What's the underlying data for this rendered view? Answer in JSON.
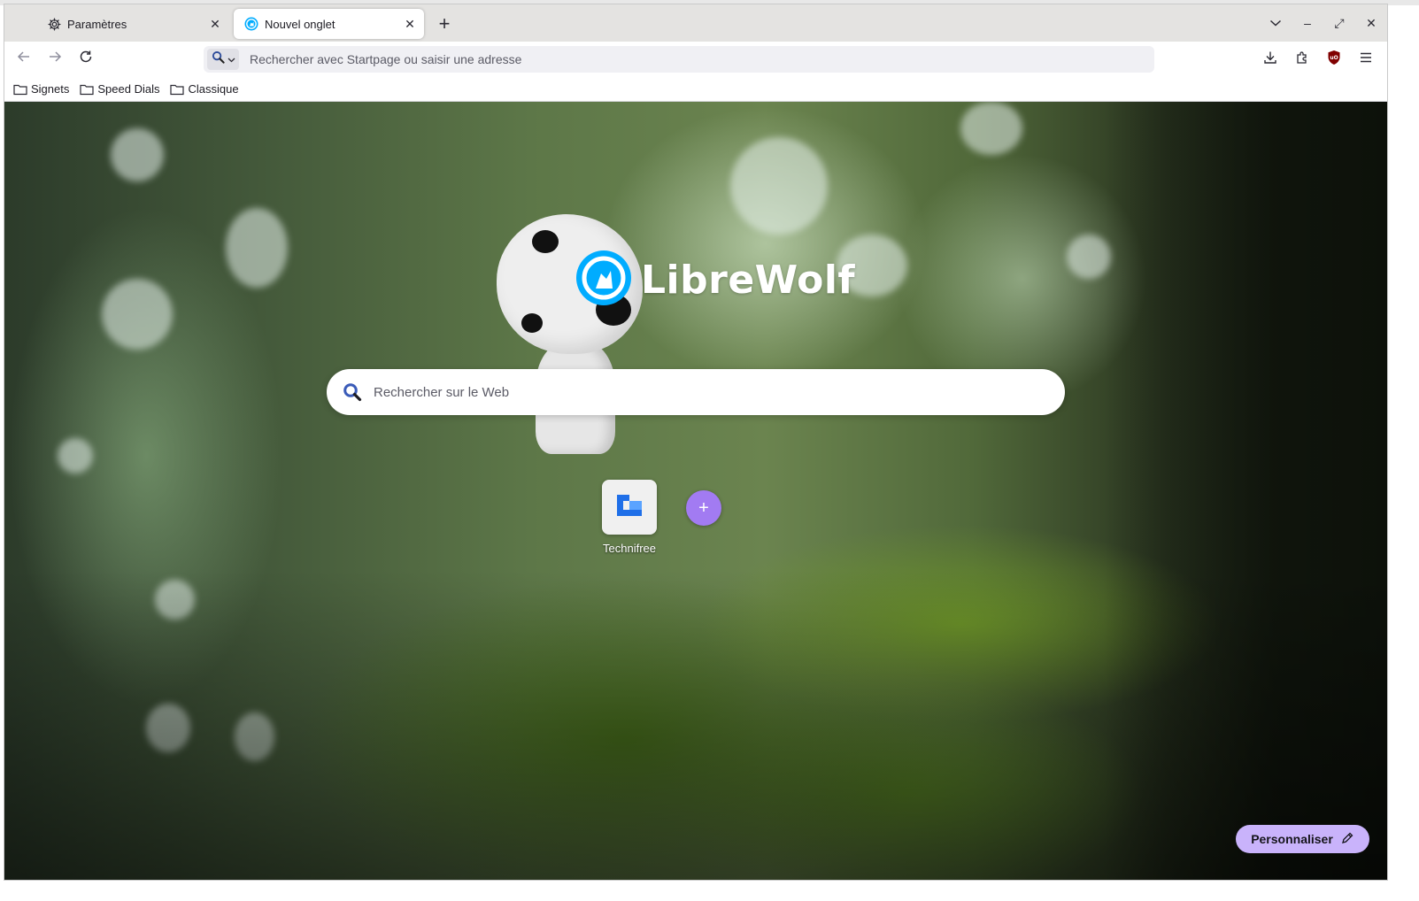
{
  "colors": {
    "tab_bar": "#e4e3e1",
    "accent_purple": "#a27bf2",
    "customize_bg": "#c9b3fb",
    "ublock_red": "#800000",
    "librewolf_blue": "#00acff"
  },
  "tabs": [
    {
      "label": "Paramètres",
      "icon": "gear-icon",
      "active": false
    },
    {
      "label": "Nouvel onglet",
      "icon": "librewolf-icon",
      "active": true
    }
  ],
  "tab_close_symbol": "✕",
  "new_tab_symbol": "+",
  "window_controls": {
    "list_all_tabs": "chevron-down-icon",
    "minimize": "–",
    "maximize": "⤢",
    "close": "✕"
  },
  "navbar": {
    "url_placeholder": "Rechercher avec Startpage ou saisir une adresse",
    "tools": [
      "download-icon",
      "extensions-icon",
      "ublock-origin-icon",
      "menu-icon"
    ]
  },
  "bookmarks": [
    {
      "label": "Signets"
    },
    {
      "label": "Speed Dials"
    },
    {
      "label": "Classique"
    }
  ],
  "newtab": {
    "logo_text": "LibreWolf",
    "search_placeholder": "Rechercher sur le Web",
    "shortcuts": [
      {
        "label": "Technifree"
      }
    ],
    "add_shortcut_symbol": "+",
    "customize_label": "Personnaliser"
  }
}
